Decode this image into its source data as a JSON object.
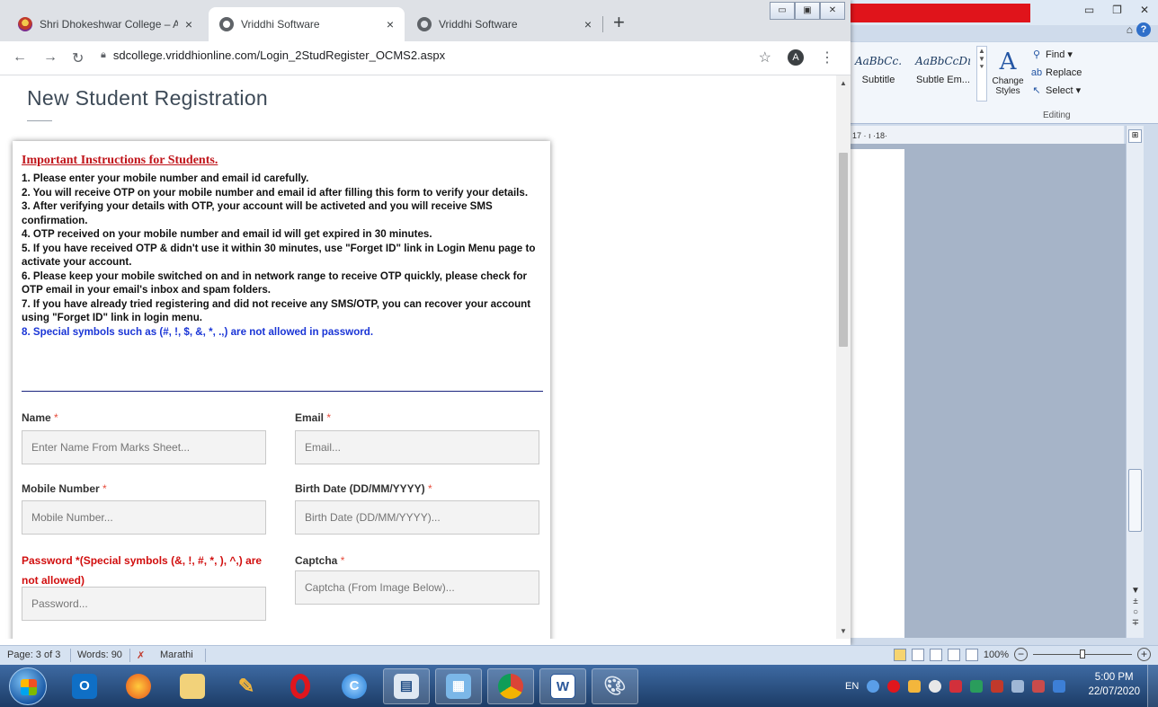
{
  "browser": {
    "tabs": [
      {
        "title": "Shri Dhokeshwar College – A/P. T",
        "close": "×"
      },
      {
        "title": "Vriddhi Software",
        "close": "×"
      },
      {
        "title": "Vriddhi Software",
        "close": "×"
      }
    ],
    "new_tab": "+",
    "url": "sdcollege.vriddhionline.com/Login_2StudRegister_OCMS2.aspx",
    "account_initial": "A"
  },
  "page": {
    "title": "New Student Registration",
    "instructions_heading": "Important Instructions for Students.",
    "instructions": [
      "1. Please enter your mobile number and email id carefully.",
      "2. You will receive OTP on your mobile number and email id after filling this form to verify your details.",
      "3. After verifying your details with OTP, your account will be activeted and you will receive SMS confirmation.",
      "4. OTP received on your mobile number and email id will get expired in 30 minutes.",
      "5. If you have received OTP & didn't use it within 30 minutes, use \"Forget ID\" link in Login Menu page to activate your account.",
      "6. Please keep your mobile switched on and in network range to receive OTP quickly, please check for OTP email in your email's inbox and spam folders.",
      "7. If you have already tried registering and did not receive any SMS/OTP, you can recover your account using \"Forget ID\" link in login menu."
    ],
    "instruction_note": "8. Special symbols such as (#, !, $, &, *, .,) are not allowed in password.",
    "form": {
      "name_label": "Name",
      "name_placeholder": "Enter Name From Marks Sheet...",
      "email_label": "Email",
      "email_placeholder": "Email...",
      "mobile_label": "Mobile Number",
      "mobile_placeholder": "Mobile Number...",
      "birth_label": "Birth Date (DD/MM/YYYY)",
      "birth_placeholder": "Birth Date (DD/MM/YYYY)...",
      "password_label": "Password *(Special symbols (&, !, #, *, ), ^,) are not allowed)",
      "password_placeholder": "Password...",
      "captcha_label": "Captcha",
      "captcha_placeholder": "Captcha (From Image Below)...",
      "required_mark": "*"
    }
  },
  "word": {
    "ribbon": {
      "style1_sample": "AaBbCc.",
      "style1_name": "Subtitle",
      "style2_sample": "AaBbCcDı",
      "style2_name": "Subtle Em...",
      "change_styles": "Change Styles",
      "find": "Find",
      "replace": "Replace",
      "select": "Select",
      "editing_group": "Editing"
    },
    "ruler": "17 · ı ·18·",
    "status": {
      "page": "Page: 3 of 3",
      "words": "Words: 90",
      "language": "Marathi",
      "zoom": "100%"
    }
  },
  "taskbar": {
    "apps": [
      "outlook",
      "firefox",
      "file-explorer",
      "paint-brush",
      "opera",
      "chrome-alt",
      "window-app",
      "control-panel",
      "chrome",
      "word",
      "paint"
    ],
    "tray_lang": "EN",
    "time": "5:00 PM",
    "date": "22/07/2020"
  },
  "colors": {
    "instruction_heading": "#c0141a",
    "instruction_note": "#1a35d6",
    "required": "#e74c3c",
    "password_label": "#d10e0e"
  }
}
